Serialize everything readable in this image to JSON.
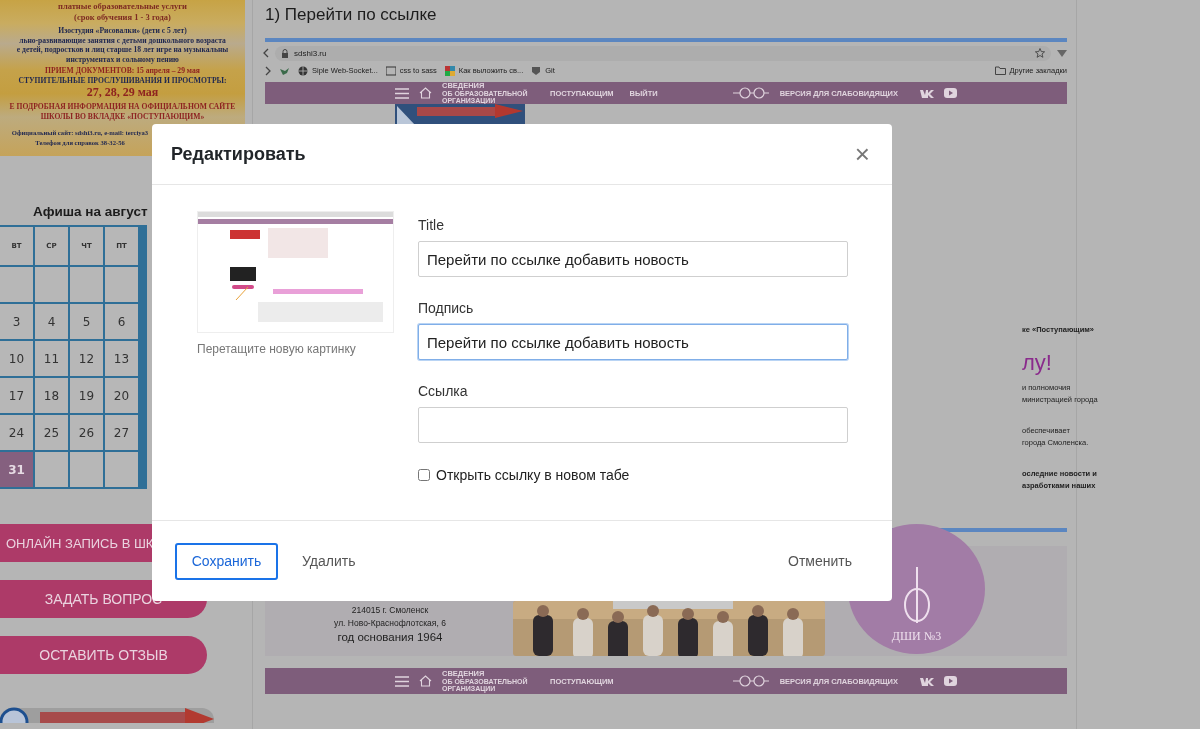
{
  "poster": {
    "lines": [
      {
        "text": "платные образовательные услуги",
        "kind": "heading"
      },
      {
        "text": "(срок обучения 1 - 3 года)",
        "kind": "heading"
      },
      {
        "text": "Изостудия «Рисовалки» (дети с 5 лет)",
        "kind": "normal"
      },
      {
        "text": "льно-развивающие занятия с детьми дошкольного возраста",
        "kind": "normal"
      },
      {
        "text": "е детей, подростков и лиц старше 18 лет игре на музыкальны",
        "kind": "normal"
      },
      {
        "text": "инструментах и сольному пению",
        "kind": "normal"
      },
      {
        "text": "ПРИЕМ ДОКУМЕНТОВ: 15 апреля – 29 мая",
        "kind": "accent"
      },
      {
        "text": "СТУПИТЕЛЬНЫЕ ПРОСЛУШИВАНИЯ И ПРОСМОТРЫ:",
        "kind": "normal"
      },
      {
        "text": "27, 28, 29 мая",
        "kind": "big"
      },
      {
        "text": "Е ПОДРОБНАЯ ИНФОРМАЦИЯ НА ОФИЦИАЛЬНОМ САЙТЕ",
        "kind": "accent"
      },
      {
        "text": "ШКОЛЫ ВО ВКЛАДКЕ «ПОСТУПАЮЩИМ»",
        "kind": "accent"
      },
      {
        "text": "Официальный сайт: sdshi3.ru, e-mail: terciya3",
        "kind": "small"
      },
      {
        "text": "Телефон для справок 38-32-56",
        "kind": "small"
      }
    ]
  },
  "calendar": {
    "title": "Афиша на август",
    "weekdays": [
      "ВТ",
      "СР",
      "ЧТ",
      "ПТ"
    ],
    "weeks": [
      [
        {
          "selected": false
        },
        {
          "selected": false
        },
        {
          "selected": false
        },
        {
          "selected": false
        }
      ],
      [
        {
          "day": "3",
          "selected": false
        },
        {
          "day": "4",
          "selected": false
        },
        {
          "day": "5",
          "selected": false
        },
        {
          "day": "6",
          "selected": false
        }
      ],
      [
        {
          "day": "10",
          "selected": false
        },
        {
          "day": "11",
          "selected": false
        },
        {
          "day": "12",
          "selected": false
        },
        {
          "day": "13",
          "selected": false
        }
      ],
      [
        {
          "day": "17",
          "selected": false
        },
        {
          "day": "18",
          "selected": false
        },
        {
          "day": "19",
          "selected": false
        },
        {
          "day": "20",
          "selected": false
        }
      ],
      [
        {
          "day": "24",
          "selected": false
        },
        {
          "day": "25",
          "selected": false
        },
        {
          "day": "26",
          "selected": false
        },
        {
          "day": "27",
          "selected": false
        }
      ],
      [
        {
          "day": "31",
          "selected": true
        },
        {
          "selected": false
        },
        {
          "selected": false
        },
        {
          "selected": false
        }
      ]
    ]
  },
  "side_buttons": [
    {
      "label": "ОНЛАЙН ЗАПИСЬ В ШК"
    },
    {
      "label": "ЗАДАТЬ ВОПРОС"
    },
    {
      "label": "ОСТАВИТЬ ОТЗЫВ"
    }
  ],
  "content": {
    "heading": "1) Перейти по ссылке",
    "browser": {
      "url": "sdshi3.ru",
      "bookmarks": [
        "Siple Web-Socket...",
        "css to sass",
        "Как выложить св...",
        "Git"
      ],
      "other_bookmarks": "Другие закладки"
    },
    "nav_top": {
      "items": [
        {
          "label": "СВЕДЕНИЯ",
          "sub": "ОБ ОБРАЗОВАТЕЛЬНОЙ ОРГАНИЗАЦИИ"
        },
        {
          "label": "ПОСТУПАЮЩИМ"
        },
        {
          "label": "ВЫЙТИ"
        }
      ],
      "accessibility": "ВЕРСИЯ ДЛЯ СЛАБОВИДЯЩИХ"
    },
    "right_text": [
      {
        "kind": "bold",
        "lines": [
          "ке «Поступающим»"
        ]
      },
      {
        "kind": "title",
        "lines": [
          "лу!"
        ]
      },
      {
        "kind": "normal",
        "lines": [
          "и полномочия",
          "министрацией города"
        ]
      },
      {
        "kind": "normal",
        "lines": [
          "обеспечивает",
          "города Смоленска."
        ]
      },
      {
        "kind": "bold",
        "lines": [
          "оследние новости и",
          "азработками наших"
        ]
      }
    ],
    "footer": {
      "address": [
        {
          "text": "214015 г. Смоленск",
          "kind": "normal"
        },
        {
          "text": "ул. Ново-Краснофлотская, 6",
          "kind": "normal"
        },
        {
          "text": "год основания 1964",
          "kind": "strong"
        }
      ],
      "logo_text": "ДШИ №3"
    },
    "nav_bottom": {
      "items": [
        {
          "label": "СВЕДЕНИЯ",
          "sub": "ОБ ОБРАЗОВАТЕЛЬНОЙ ОРГАНИЗАЦИИ"
        },
        {
          "label": "ПОСТУПАЮЩИМ"
        }
      ],
      "accessibility": "ВЕРСИЯ ДЛЯ СЛАБОВИДЯЩИХ"
    }
  },
  "modal": {
    "title": "Редактировать",
    "close": "×",
    "image_caption": "Перетащите новую картинку",
    "fields": [
      {
        "label": "Title",
        "value": "Перейти по ссылке добавить новость",
        "focused": false
      },
      {
        "label": "Подпись",
        "value": "Перейти по ссылке добавить новость",
        "focused": true
      },
      {
        "label": "Ссылка",
        "focused": false
      }
    ],
    "new_tab": {
      "label": "Открыть ссылку в новом табе",
      "checked": false
    },
    "buttons": [
      {
        "label": "Сохранить",
        "kind": "primary"
      },
      {
        "label": "Удалить",
        "kind": "text"
      },
      {
        "label": "Отменить",
        "kind": "text"
      }
    ]
  }
}
